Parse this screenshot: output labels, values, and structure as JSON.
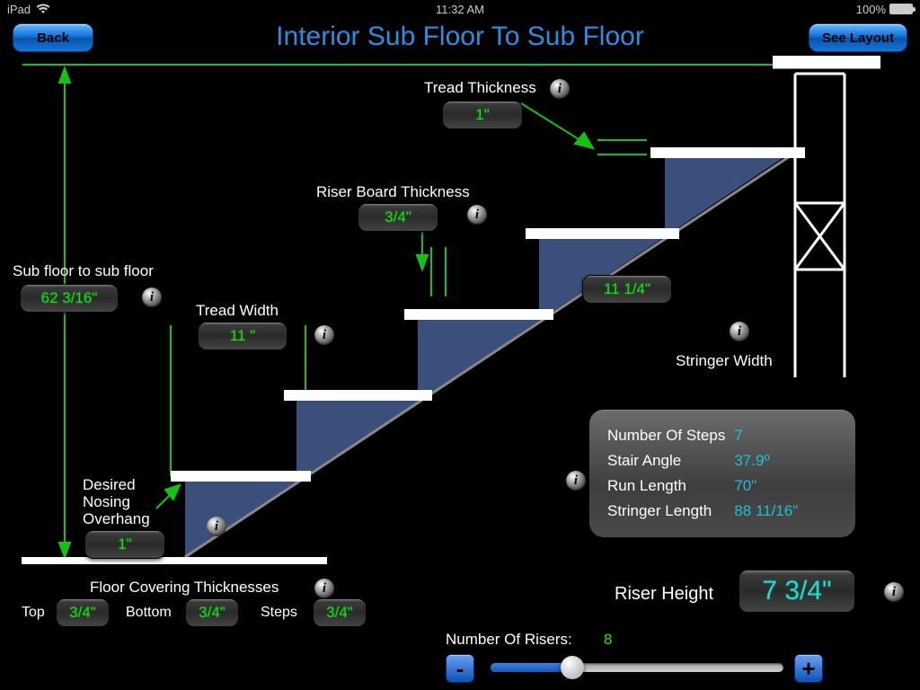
{
  "status": {
    "device": "iPad",
    "time": "11:32 AM",
    "battery": "100%"
  },
  "header": {
    "title": "Interior Sub Floor To Sub Floor",
    "back": "Back",
    "see_layout": "See Layout"
  },
  "labels": {
    "tread_thickness": "Tread Thickness",
    "riser_board_thickness": "Riser Board Thickness",
    "sub_floor": "Sub floor to sub floor",
    "tread_width": "Tread Width",
    "stringer_width": "Stringer Width",
    "nosing_l1": "Desired",
    "nosing_l2": "Nosing",
    "nosing_l3": "Overhang",
    "floor_cov": "Floor Covering Thicknesses",
    "top": "Top",
    "bottom": "Bottom",
    "steps": "Steps",
    "riser_height": "Riser Height",
    "num_risers": "Number Of Risers:"
  },
  "values": {
    "tread_thickness": "1\"",
    "riser_board_thickness": "3/4\"",
    "sub_floor": "62 3/16\"",
    "tread_width": "11 \"",
    "stringer_width": "11 1/4\"",
    "nosing": "1\"",
    "fc_top": "3/4\"",
    "fc_bottom": "3/4\"",
    "fc_steps": "3/4\"",
    "riser_height": "7 3/4\"",
    "num_risers": "8"
  },
  "results": {
    "rows": [
      {
        "k": "Number Of Steps",
        "v": "7"
      },
      {
        "k": "Stair Angle",
        "v": "37.9º"
      },
      {
        "k": "Run Length",
        "v": "70\""
      },
      {
        "k": "Stringer Length",
        "v": "88 11/16\""
      }
    ]
  },
  "icons": {
    "info_glyph": "i"
  }
}
